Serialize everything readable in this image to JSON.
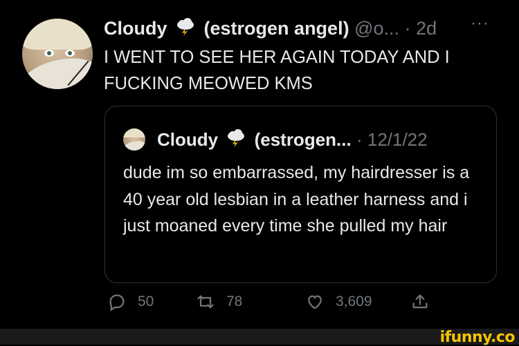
{
  "tweet": {
    "author_name": "Cloudy",
    "author_name_suffix": "(estrogen angel)",
    "handle": "@o...",
    "separator": "·",
    "time": "2d",
    "more": "···",
    "text": "I WENT TO SEE HER AGAIN TODAY AND I FUCKING MEOWED KMS"
  },
  "quoted": {
    "author_name": "Cloudy",
    "author_name_suffix": "(estrogen...",
    "separator": "·",
    "date": "12/1/22",
    "text": "dude im so embarrassed, my hairdresser is a 40 year old lesbian in a leather harness and i just moaned every time she pulled my hair"
  },
  "actions": {
    "replies": "50",
    "retweets": "78",
    "likes": "3,609"
  },
  "watermark": "ifunny.co",
  "icons": {
    "name_emoji": "storm-cloud-icon",
    "reply": "reply-icon",
    "retweet": "retweet-icon",
    "like": "heart-icon",
    "share": "share-icon",
    "more": "more-icon"
  },
  "colors": {
    "background": "#000000",
    "primary_text": "#e7e9ea",
    "secondary_text": "#71767b",
    "border": "#2f3336",
    "brand": "#f5c400"
  }
}
